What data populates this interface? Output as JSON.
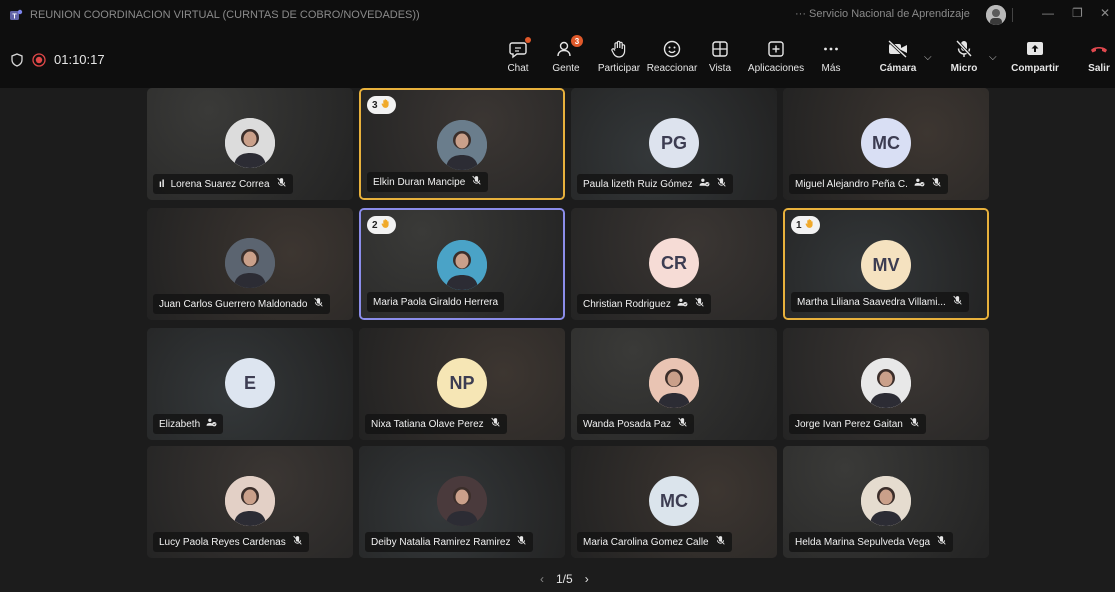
{
  "window": {
    "title": "REUNION COORDINACION VIRTUAL (CURNTAS DE COBRO/NOVEDADES))",
    "org": "··· Servicio Nacional de Aprendizaje"
  },
  "call": {
    "timer": "01:10:17"
  },
  "toolbar": {
    "chat": "Chat",
    "people": "Gente",
    "people_badge": "3",
    "raise": "Participar",
    "react": "Reaccionar",
    "view": "Vista",
    "apps": "Aplicaciones",
    "more": "Más",
    "camera": "Cámara",
    "mic": "Micro",
    "share": "Compartir",
    "leave": "Salir"
  },
  "participants": [
    {
      "name": "Lorena Suarez Correa",
      "initials": "",
      "signal": "ıl",
      "mic_muted": true,
      "hand": "",
      "highlight": "",
      "avatar_type": "photo",
      "avatar_color": "#dcdcdc"
    },
    {
      "name": "Elkin Duran Mancipe",
      "initials": "",
      "mic_muted": true,
      "hand": "3",
      "highlight": "gold",
      "avatar_type": "photo",
      "avatar_color": "#6a7d8c"
    },
    {
      "name": "Paula lizeth Ruiz Gómez",
      "initials": "PG",
      "mic_muted": true,
      "guest": true,
      "hand": "",
      "highlight": "",
      "avatar_type": "initials",
      "avatar_color": "#dde3ee"
    },
    {
      "name": "Miguel Alejandro Peña C.",
      "initials": "MC",
      "mic_muted": true,
      "guest": true,
      "hand": "",
      "highlight": "",
      "avatar_type": "initials",
      "avatar_color": "#d9dff4"
    },
    {
      "name": "Juan Carlos Guerrero Maldonado",
      "initials": "",
      "mic_muted": true,
      "hand": "",
      "highlight": "",
      "avatar_type": "photo",
      "avatar_color": "#5b6470"
    },
    {
      "name": "Maria Paola Giraldo Herrera",
      "initials": "",
      "mic_muted": false,
      "hand": "2",
      "highlight": "blue",
      "avatar_type": "photo",
      "avatar_color": "#4aa3c7"
    },
    {
      "name": "Christian Rodriguez",
      "initials": "CR",
      "mic_muted": true,
      "guest": true,
      "hand": "",
      "highlight": "",
      "avatar_type": "initials",
      "avatar_color": "#f6dcd6"
    },
    {
      "name": "Martha Liliana Saavedra Villami...",
      "initials": "MV",
      "mic_muted": true,
      "hand": "1",
      "highlight": "gold",
      "avatar_type": "initials",
      "avatar_color": "#f5e2c0"
    },
    {
      "name": "Elizabeth",
      "initials": "E",
      "mic_muted": false,
      "guest": true,
      "hand": "",
      "highlight": "",
      "avatar_type": "initials",
      "avatar_color": "#dde5f0"
    },
    {
      "name": "Nixa Tatiana Olave Perez",
      "initials": "NP",
      "mic_muted": true,
      "hand": "",
      "highlight": "",
      "avatar_type": "initials",
      "avatar_color": "#f6e6b5"
    },
    {
      "name": "Wanda Posada Paz",
      "initials": "",
      "mic_muted": true,
      "hand": "",
      "highlight": "",
      "avatar_type": "photo",
      "avatar_color": "#e9c4b3"
    },
    {
      "name": "Jorge Ivan Perez Gaitan",
      "initials": "",
      "mic_muted": true,
      "hand": "",
      "highlight": "",
      "avatar_type": "photo",
      "avatar_color": "#e8e8e8"
    },
    {
      "name": "Lucy Paola Reyes Cardenas",
      "initials": "",
      "mic_muted": true,
      "hand": "",
      "highlight": "",
      "avatar_type": "photo",
      "avatar_color": "#e3d0c6"
    },
    {
      "name": "Deiby Natalia Ramirez Ramirez",
      "initials": "",
      "mic_muted": true,
      "hand": "",
      "highlight": "",
      "avatar_type": "photo",
      "avatar_color": "#4a3a3c"
    },
    {
      "name": "Maria Carolina Gomez Calle",
      "initials": "MC",
      "mic_muted": true,
      "hand": "",
      "highlight": "",
      "avatar_type": "initials",
      "avatar_color": "#dbe4ec"
    },
    {
      "name": "Helda Marina Sepulveda Vega",
      "initials": "",
      "mic_muted": true,
      "hand": "",
      "highlight": "",
      "avatar_type": "photo",
      "avatar_color": "#e5dccf"
    }
  ],
  "pager": {
    "label": "1/5"
  }
}
